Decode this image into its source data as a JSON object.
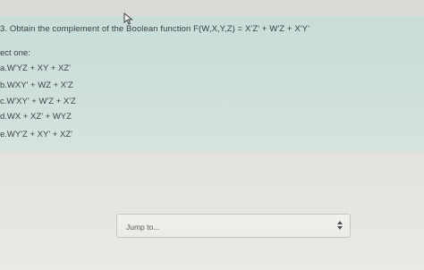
{
  "question": {
    "text": "3. Obtain the complement of the Boolean function F(W,X,Y,Z) = X'Z' + W'Z + X'Y'",
    "select_label": "ect one:"
  },
  "options": [
    {
      "label": "a.W'YZ + XY + XZ'"
    },
    {
      "label": "b.WXY' + WZ + X'Z"
    },
    {
      "label": "c.W'XY' + W'Z + X'Z"
    },
    {
      "label": "d.WX + XZ' + WYZ"
    },
    {
      "label": "e.WY'Z + XY' + XZ'"
    }
  ],
  "navigation": {
    "jump_placeholder": "Jump to...",
    "arrows_icon": "updown-arrows-icon"
  },
  "colors": {
    "question_bg": "#cfe0dc",
    "page_bg": "#e5e3de",
    "text": "#3a3f42"
  }
}
